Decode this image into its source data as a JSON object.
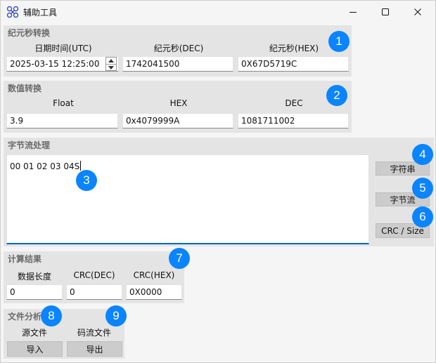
{
  "window": {
    "title": "辅助工具",
    "controls": [
      "minimize-icon",
      "maximize-icon",
      "close-icon"
    ]
  },
  "epoch": {
    "title": "纪元秒转换",
    "col_datetime": "日期时间(UTC)",
    "col_dec": "纪元秒(DEC)",
    "col_hex": "纪元秒(HEX)",
    "datetime_value": "2025-03-15 12:25:00",
    "dec_value": "1742041500",
    "hex_value": "0X67D5719C"
  },
  "numeric": {
    "title": "数值转换",
    "col_float": "Float",
    "col_hex": "HEX",
    "col_dec": "DEC",
    "float_value": "3.9",
    "hex_value": "0x4079999A",
    "dec_value": "1081711002"
  },
  "bytestream": {
    "title": "字节流处理",
    "content": "00 01 02 03 04S",
    "btn_string": "字符串",
    "btn_bytes": "字节流",
    "btn_crc": "CRC / Size"
  },
  "result": {
    "title": "计算结果",
    "col_length": "数据长度",
    "col_crc_dec": "CRC(DEC)",
    "col_crc_hex": "CRC(HEX)",
    "length_value": "0",
    "crc_dec_value": "0",
    "crc_hex_value": "0X0000"
  },
  "file": {
    "title": "文件分析",
    "col_source": "源文件",
    "col_stream": "码流文件",
    "btn_import": "导入",
    "btn_export": "导出"
  },
  "badges": [
    "1",
    "2",
    "3",
    "4",
    "5",
    "6",
    "7",
    "8",
    "9"
  ],
  "colors": {
    "badge": "#0a84ff",
    "focus_underline": "#0067c0"
  }
}
